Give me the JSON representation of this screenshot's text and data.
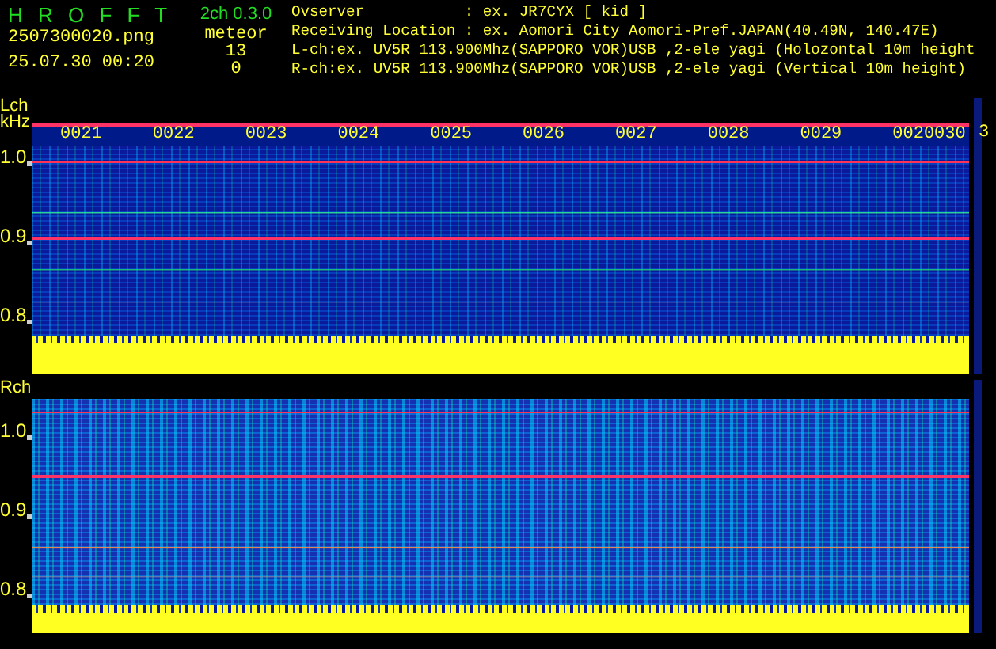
{
  "header": {
    "app_title": "H R O F F T",
    "version": "2ch 0.3.0",
    "file_name": "2507300020.png",
    "mode": "meteor",
    "date_time": "25.07.30 00:20",
    "counts": [
      "13",
      "0"
    ],
    "info_lines": [
      "Ovserver           : ex. JR7CYX [ kid ]",
      "Receiving Location : ex. Aomori City Aomori-Pref.JAPAN(40.49N, 140.47E)",
      "L-ch:ex. UV5R 113.900Mhz(SAPPORO VOR)USB ,2-ele yagi (Holozontal 10m height",
      "R-ch:ex. UV5R 113.900Mhz(SAPPORO VOR)USB ,2-ele yagi (Vertical 10m height)"
    ]
  },
  "panels": [
    {
      "channel": "Lch",
      "unit": "kHz",
      "time_labels": [
        "0021",
        "0022",
        "0023",
        "0024",
        "0025",
        "0026",
        "0027",
        "0028",
        "0029",
        "0020030"
      ],
      "y_labels": [
        "1.0",
        "0.9",
        "0.8"
      ]
    },
    {
      "channel": "Rch",
      "y_labels": [
        "1.0",
        "0.9",
        "0.8"
      ]
    }
  ],
  "edge_label": "3"
}
